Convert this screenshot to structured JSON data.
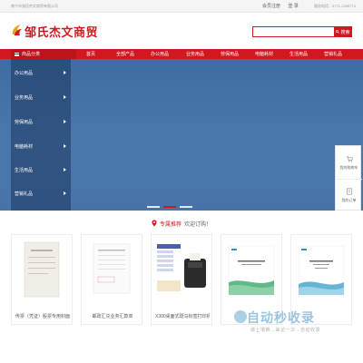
{
  "topbar": {
    "company": "南宁市邹氏杰文商贸有限公司",
    "login": "会员注册",
    "register": "登 录",
    "phone": "服务电话：0771-2289774"
  },
  "header": {
    "logo_text_1": "邹氏",
    "logo_text_2": "杰文商贸",
    "search_placeholder": "",
    "search_button": "搜索"
  },
  "nav": {
    "category_label": "商品分类",
    "items": [
      "首页",
      "全部产品",
      "办公用品",
      "业务用品",
      "劳保用品",
      "电脑耗材",
      "生活用品",
      "营销礼品"
    ]
  },
  "sidebar": {
    "items": [
      "办公用品",
      "业务用品",
      "劳保用品",
      "电脑耗材",
      "生活用品",
      "营销礼品"
    ]
  },
  "float": {
    "cart": "我的购物车",
    "orders": "我的订单"
  },
  "recommend": {
    "title": "专属推荐",
    "subtitle": "欢迎订购！"
  },
  "products": [
    {
      "name": "传票（凭证）股票专用封面装订"
    },
    {
      "name": "邮政汇兑业务汇款单"
    },
    {
      "name": "X300桌面式斑马标签打印机"
    },
    {
      "name": ""
    },
    {
      "name": ""
    }
  ],
  "watermark": {
    "main": "自动秒收录",
    "sub": "做上墙推→来访一次→自动收录"
  },
  "colors": {
    "brand_red": "#d0181e",
    "banner_blue": "#4471a7"
  }
}
